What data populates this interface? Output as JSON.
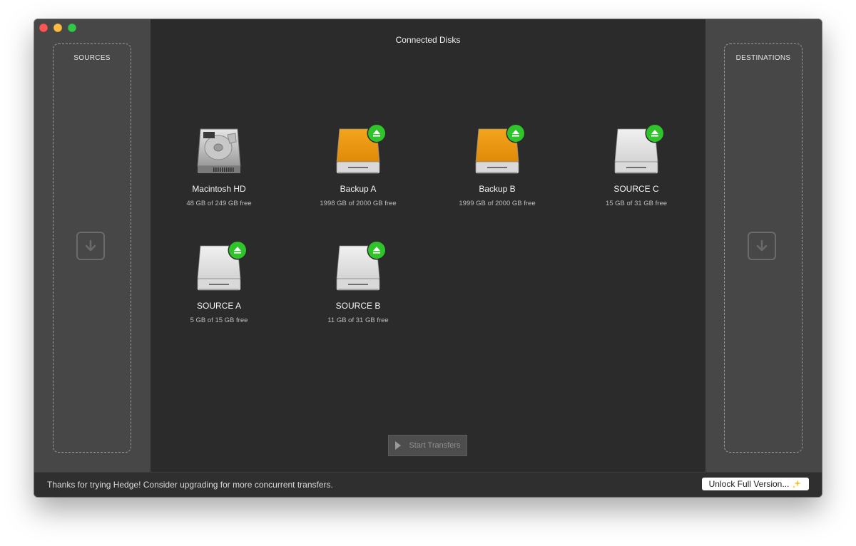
{
  "window": {
    "title": "Connected Disks"
  },
  "sources": {
    "label": "SOURCES",
    "drop_icon": "arrow-down-icon"
  },
  "destinations": {
    "label": "DESTINATIONS",
    "drop_icon": "arrow-down-icon"
  },
  "disks": [
    {
      "name": "Macintosh HD",
      "free": "48 GB of 249 GB free",
      "type": "internal",
      "ejectable": false
    },
    {
      "name": "Backup A",
      "free": "1998 GB of 2000 GB free",
      "type": "external-orange",
      "ejectable": true
    },
    {
      "name": "Backup B",
      "free": "1999 GB of 2000 GB free",
      "type": "external-orange",
      "ejectable": true
    },
    {
      "name": "SOURCE C",
      "free": "15 GB of 31 GB free",
      "type": "external-white",
      "ejectable": true
    },
    {
      "name": "SOURCE A",
      "free": "5 GB of 15 GB free",
      "type": "external-white",
      "ejectable": true
    },
    {
      "name": "SOURCE B",
      "free": "11 GB of 31 GB free",
      "type": "external-white",
      "ejectable": true
    }
  ],
  "actions": {
    "start_label": "Start Transfers"
  },
  "footer": {
    "message": "Thanks for trying Hedge! Consider upgrading for more concurrent transfers.",
    "unlock_label": "Unlock Full Version...",
    "unlock_icon": "sparkles-icon"
  },
  "colors": {
    "eject_green": "#2fc42a",
    "backup_orange": "#f3a51c",
    "panel_gray": "#474747",
    "center_bg": "#2b2b2b"
  }
}
